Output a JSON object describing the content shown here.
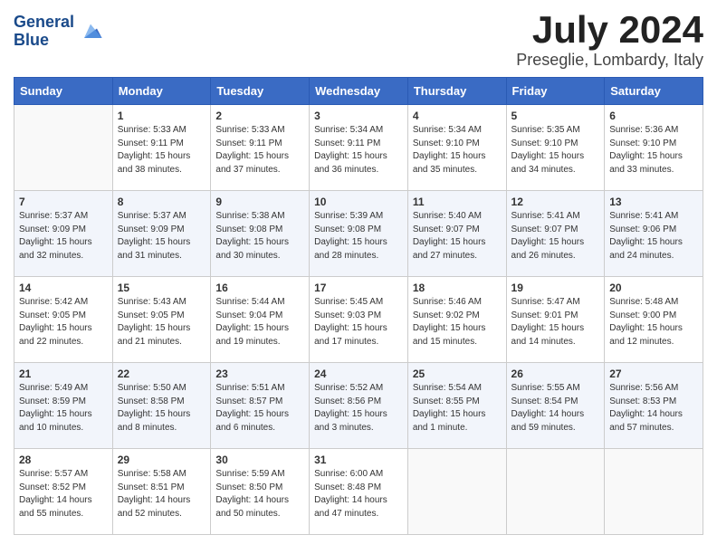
{
  "header": {
    "logo_line1": "General",
    "logo_line2": "Blue",
    "month": "July 2024",
    "location": "Preseglie, Lombardy, Italy"
  },
  "days_of_week": [
    "Sunday",
    "Monday",
    "Tuesday",
    "Wednesday",
    "Thursday",
    "Friday",
    "Saturday"
  ],
  "weeks": [
    [
      {
        "day": "",
        "info": ""
      },
      {
        "day": "1",
        "info": "Sunrise: 5:33 AM\nSunset: 9:11 PM\nDaylight: 15 hours\nand 38 minutes."
      },
      {
        "day": "2",
        "info": "Sunrise: 5:33 AM\nSunset: 9:11 PM\nDaylight: 15 hours\nand 37 minutes."
      },
      {
        "day": "3",
        "info": "Sunrise: 5:34 AM\nSunset: 9:11 PM\nDaylight: 15 hours\nand 36 minutes."
      },
      {
        "day": "4",
        "info": "Sunrise: 5:34 AM\nSunset: 9:10 PM\nDaylight: 15 hours\nand 35 minutes."
      },
      {
        "day": "5",
        "info": "Sunrise: 5:35 AM\nSunset: 9:10 PM\nDaylight: 15 hours\nand 34 minutes."
      },
      {
        "day": "6",
        "info": "Sunrise: 5:36 AM\nSunset: 9:10 PM\nDaylight: 15 hours\nand 33 minutes."
      }
    ],
    [
      {
        "day": "7",
        "info": "Sunrise: 5:37 AM\nSunset: 9:09 PM\nDaylight: 15 hours\nand 32 minutes."
      },
      {
        "day": "8",
        "info": "Sunrise: 5:37 AM\nSunset: 9:09 PM\nDaylight: 15 hours\nand 31 minutes."
      },
      {
        "day": "9",
        "info": "Sunrise: 5:38 AM\nSunset: 9:08 PM\nDaylight: 15 hours\nand 30 minutes."
      },
      {
        "day": "10",
        "info": "Sunrise: 5:39 AM\nSunset: 9:08 PM\nDaylight: 15 hours\nand 28 minutes."
      },
      {
        "day": "11",
        "info": "Sunrise: 5:40 AM\nSunset: 9:07 PM\nDaylight: 15 hours\nand 27 minutes."
      },
      {
        "day": "12",
        "info": "Sunrise: 5:41 AM\nSunset: 9:07 PM\nDaylight: 15 hours\nand 26 minutes."
      },
      {
        "day": "13",
        "info": "Sunrise: 5:41 AM\nSunset: 9:06 PM\nDaylight: 15 hours\nand 24 minutes."
      }
    ],
    [
      {
        "day": "14",
        "info": "Sunrise: 5:42 AM\nSunset: 9:05 PM\nDaylight: 15 hours\nand 22 minutes."
      },
      {
        "day": "15",
        "info": "Sunrise: 5:43 AM\nSunset: 9:05 PM\nDaylight: 15 hours\nand 21 minutes."
      },
      {
        "day": "16",
        "info": "Sunrise: 5:44 AM\nSunset: 9:04 PM\nDaylight: 15 hours\nand 19 minutes."
      },
      {
        "day": "17",
        "info": "Sunrise: 5:45 AM\nSunset: 9:03 PM\nDaylight: 15 hours\nand 17 minutes."
      },
      {
        "day": "18",
        "info": "Sunrise: 5:46 AM\nSunset: 9:02 PM\nDaylight: 15 hours\nand 15 minutes."
      },
      {
        "day": "19",
        "info": "Sunrise: 5:47 AM\nSunset: 9:01 PM\nDaylight: 15 hours\nand 14 minutes."
      },
      {
        "day": "20",
        "info": "Sunrise: 5:48 AM\nSunset: 9:00 PM\nDaylight: 15 hours\nand 12 minutes."
      }
    ],
    [
      {
        "day": "21",
        "info": "Sunrise: 5:49 AM\nSunset: 8:59 PM\nDaylight: 15 hours\nand 10 minutes."
      },
      {
        "day": "22",
        "info": "Sunrise: 5:50 AM\nSunset: 8:58 PM\nDaylight: 15 hours\nand 8 minutes."
      },
      {
        "day": "23",
        "info": "Sunrise: 5:51 AM\nSunset: 8:57 PM\nDaylight: 15 hours\nand 6 minutes."
      },
      {
        "day": "24",
        "info": "Sunrise: 5:52 AM\nSunset: 8:56 PM\nDaylight: 15 hours\nand 3 minutes."
      },
      {
        "day": "25",
        "info": "Sunrise: 5:54 AM\nSunset: 8:55 PM\nDaylight: 15 hours\nand 1 minute."
      },
      {
        "day": "26",
        "info": "Sunrise: 5:55 AM\nSunset: 8:54 PM\nDaylight: 14 hours\nand 59 minutes."
      },
      {
        "day": "27",
        "info": "Sunrise: 5:56 AM\nSunset: 8:53 PM\nDaylight: 14 hours\nand 57 minutes."
      }
    ],
    [
      {
        "day": "28",
        "info": "Sunrise: 5:57 AM\nSunset: 8:52 PM\nDaylight: 14 hours\nand 55 minutes."
      },
      {
        "day": "29",
        "info": "Sunrise: 5:58 AM\nSunset: 8:51 PM\nDaylight: 14 hours\nand 52 minutes."
      },
      {
        "day": "30",
        "info": "Sunrise: 5:59 AM\nSunset: 8:50 PM\nDaylight: 14 hours\nand 50 minutes."
      },
      {
        "day": "31",
        "info": "Sunrise: 6:00 AM\nSunset: 8:48 PM\nDaylight: 14 hours\nand 47 minutes."
      },
      {
        "day": "",
        "info": ""
      },
      {
        "day": "",
        "info": ""
      },
      {
        "day": "",
        "info": ""
      }
    ]
  ]
}
